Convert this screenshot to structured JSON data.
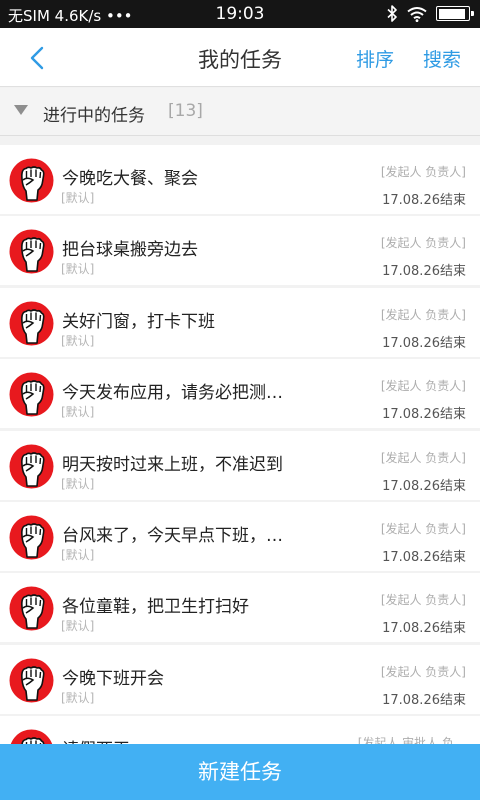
{
  "status_bar": {
    "left_text": "无SIM 4.6K/s •••",
    "time": "19:03",
    "icons": [
      "bluetooth-icon",
      "wifi-icon",
      "battery-icon"
    ],
    "battery_level": 0.9
  },
  "nav": {
    "back_icon": "chevron-left-icon",
    "title": "我的任务",
    "sort_label": "排序",
    "search_label": "搜索"
  },
  "section": {
    "label": "进行中的任务",
    "count": "[13]"
  },
  "tasks": [
    {
      "title": "今晚吃大餐、聚会",
      "tag": "[默认]",
      "roles": "[发起人 负责人]",
      "end": "17.08.26结束"
    },
    {
      "title": "把台球桌搬旁边去",
      "tag": "[默认]",
      "roles": "[发起人 负责人]",
      "end": "17.08.26结束"
    },
    {
      "title": "关好门窗，打卡下班",
      "tag": "[默认]",
      "roles": "[发起人 负责人]",
      "end": "17.08.26结束"
    },
    {
      "title": "今天发布应用，请务必把测…",
      "tag": "[默认]",
      "roles": "[发起人 负责人]",
      "end": "17.08.26结束"
    },
    {
      "title": "明天按时过来上班，不准迟到",
      "tag": "[默认]",
      "roles": "[发起人 负责人]",
      "end": "17.08.26结束"
    },
    {
      "title": "台风来了，今天早点下班，…",
      "tag": "[默认]",
      "roles": "[发起人 负责人]",
      "end": "17.08.26结束"
    },
    {
      "title": "各位童鞋，把卫生打扫好",
      "tag": "[默认]",
      "roles": "[发起人 负责人]",
      "end": "17.08.26结束"
    },
    {
      "title": "今晚下班开会",
      "tag": "[默认]",
      "roles": "[发起人 负责人]",
      "end": "17.08.26结束"
    },
    {
      "title": "请假两天",
      "tag": "",
      "roles": "[发起人 审批人 负…",
      "end": ""
    }
  ],
  "footer": {
    "new_task_label": "新建任务"
  },
  "colors": {
    "accent": "#2f9be4",
    "footer_button": "#42b0f3",
    "avatar_red": "#e8191e"
  }
}
